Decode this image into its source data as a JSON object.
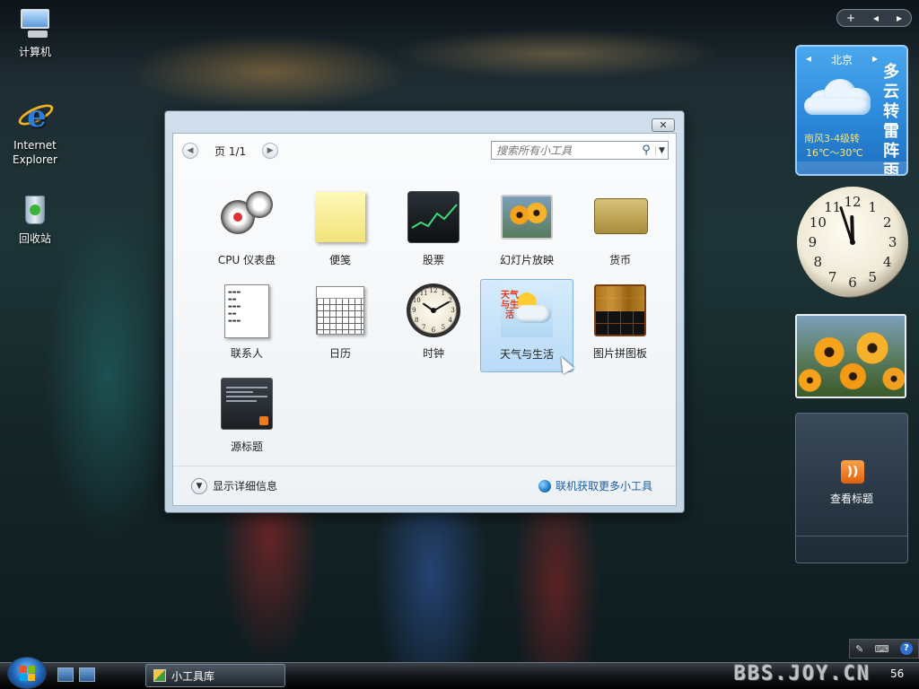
{
  "desktop": {
    "icons": [
      {
        "label": "计算机",
        "icon": "computer-icon"
      },
      {
        "label": "Internet Explorer",
        "icon": "internet-explorer-icon"
      },
      {
        "label": "回收站",
        "icon": "recycle-bin-icon"
      }
    ]
  },
  "sidebar": {
    "add_glyph": "+",
    "weather": {
      "city": "北京",
      "condition": "多云转雷阵雨",
      "condition_chars": [
        "多",
        "云",
        "转",
        "雷",
        "阵",
        "雨"
      ],
      "wind": "南风3-4级转",
      "temperature": "16℃～30℃"
    },
    "clock": {
      "hour": 11,
      "minute": 57
    },
    "feed": {
      "label": "查看标题"
    }
  },
  "dialog": {
    "close_glyph": "✕",
    "page_label": "页 1/1",
    "search_placeholder": "搜索所有小工具",
    "gadgets": [
      {
        "label": "CPU 仪表盘",
        "icon": "cpu-meter-icon"
      },
      {
        "label": "便笺",
        "icon": "notes-icon"
      },
      {
        "label": "股票",
        "icon": "stocks-icon"
      },
      {
        "label": "幻灯片放映",
        "icon": "slideshow-icon"
      },
      {
        "label": "货币",
        "icon": "currency-icon"
      },
      {
        "label": "联系人",
        "icon": "contacts-icon"
      },
      {
        "label": "日历",
        "icon": "calendar-icon"
      },
      {
        "label": "时钟",
        "icon": "clock-icon"
      },
      {
        "label": "天气与生活",
        "icon": "weather-icon",
        "selected": true
      },
      {
        "label": "图片拼图板",
        "icon": "picture-puzzle-icon"
      },
      {
        "label": "源标题",
        "icon": "feed-headlines-icon"
      }
    ],
    "weather_thumb_text": "天气与生活",
    "details_label": "显示详细信息",
    "online_label": "联机获取更多小工具"
  },
  "taskbar": {
    "task_label": "小工具库",
    "watermark": "BBS.JOY.CN",
    "time": "56"
  },
  "colors": {
    "selection": "#b9dbf7",
    "link": "#1c5fa8",
    "weather_yellow": "#ffe36b"
  }
}
